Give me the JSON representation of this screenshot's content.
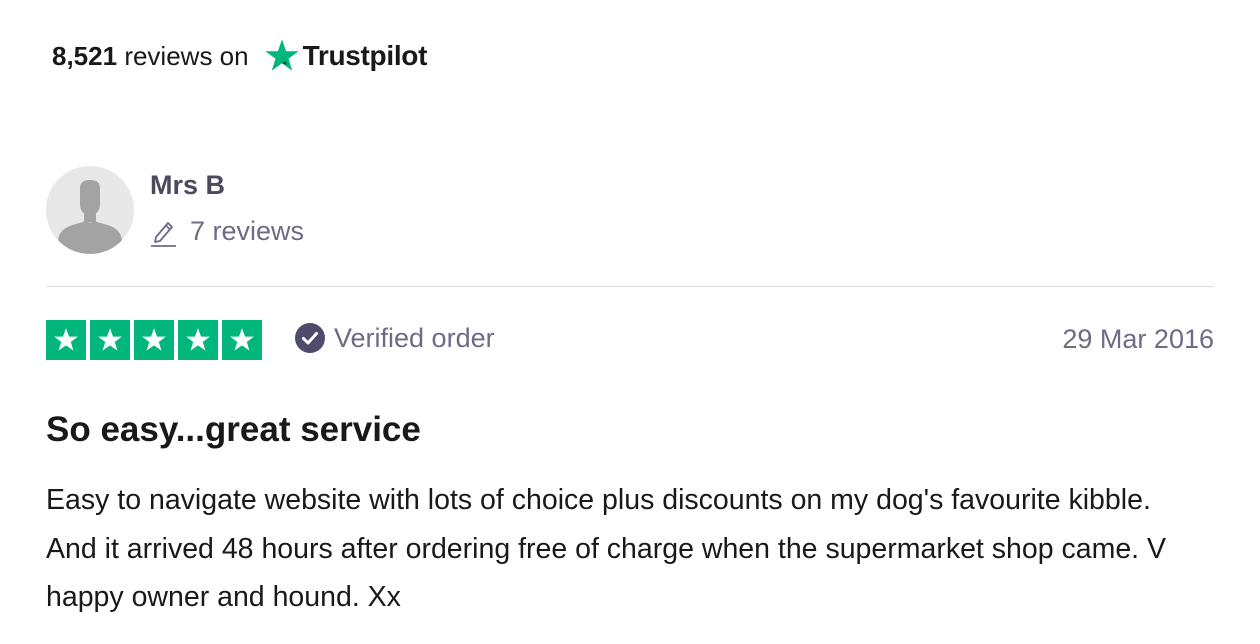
{
  "header": {
    "review_count": "8,521",
    "reviews_on": "reviews on",
    "brand_name": "Trustpilot",
    "brand_icon": "trustpilot-star-icon",
    "brand_color": "#00b67a"
  },
  "reviewer": {
    "avatar_icon": "default-avatar-icon",
    "name": "Mrs B",
    "reviews_icon": "pencil-icon",
    "review_count": "7 reviews"
  },
  "review": {
    "rating": 5,
    "rating_max": 5,
    "star_color": "#00b67a",
    "verified_icon": "check-circle-icon",
    "verified_label": "Verified order",
    "date": "29 Mar 2016",
    "title": "So easy...great service",
    "body": "Easy to navigate website with lots of choice plus discounts on my dog's favourite kibble. And it arrived 48 hours after ordering free of charge when the supermarket shop came. V happy owner and hound. Xx"
  }
}
